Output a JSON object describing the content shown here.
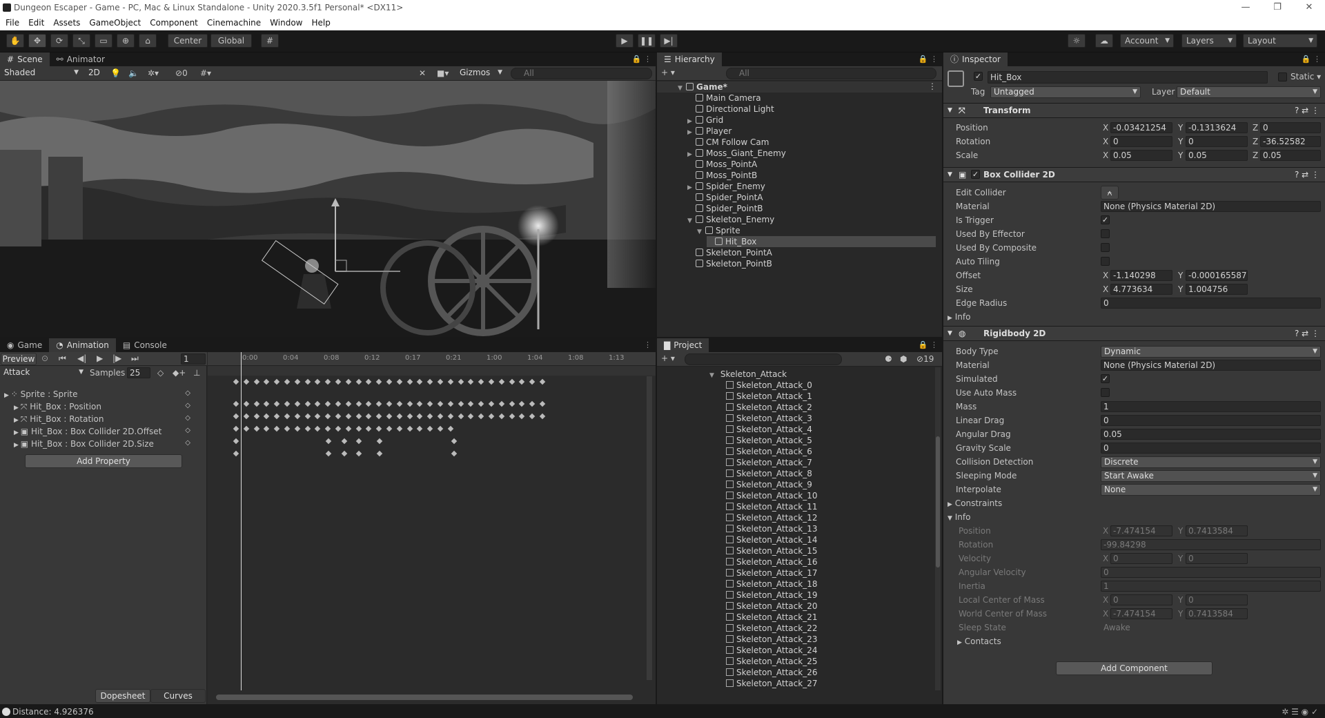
{
  "window": {
    "title": "Dungeon Escaper - Game - PC, Mac & Linux Standalone - Unity 2020.3.5f1 Personal* <DX11>"
  },
  "menu": [
    "File",
    "Edit",
    "Assets",
    "GameObject",
    "Component",
    "Cinemachine",
    "Window",
    "Help"
  ],
  "toolbar": {
    "pivot": "Center",
    "space": "Global",
    "account": "Account",
    "layers": "Layers",
    "layout": "Layout"
  },
  "scene": {
    "tabs": [
      "Scene",
      "Animator"
    ],
    "shading": "Shaded",
    "mode2d": "2D",
    "gizmos": "Gizmos",
    "search": "All",
    "hidden_count": "0"
  },
  "hierarchy": {
    "tab": "Hierarchy",
    "search": "All",
    "scene": "Game*",
    "items": [
      {
        "label": "Main Camera",
        "fold": ""
      },
      {
        "label": "Directional Light",
        "fold": ""
      },
      {
        "label": "Grid",
        "fold": "▶"
      },
      {
        "label": "Player",
        "fold": "▶"
      },
      {
        "label": "CM Follow Cam",
        "fold": ""
      },
      {
        "label": "Moss_Giant_Enemy",
        "fold": "▶"
      },
      {
        "label": "Moss_PointA",
        "fold": ""
      },
      {
        "label": "Moss_PointB",
        "fold": ""
      },
      {
        "label": "Spider_Enemy",
        "fold": "▶"
      },
      {
        "label": "Spider_PointA",
        "fold": ""
      },
      {
        "label": "Spider_PointB",
        "fold": ""
      },
      {
        "label": "Skeleton_Enemy",
        "fold": "▼"
      },
      {
        "label": "Sprite",
        "fold": "▼"
      },
      {
        "label": "Hit_Box",
        "fold": ""
      },
      {
        "label": "Skeleton_PointA",
        "fold": ""
      },
      {
        "label": "Skeleton_PointB",
        "fold": ""
      }
    ]
  },
  "animation": {
    "tabs": [
      "Game",
      "Animation",
      "Console"
    ],
    "preview": "Preview",
    "frame": "1",
    "clip": "Attack",
    "samples_label": "Samples",
    "samples": "25",
    "ruler": [
      "0:00",
      "0:04",
      "0:08",
      "0:12",
      "0:17",
      "0:21",
      "1:00",
      "1:04",
      "1:08",
      "1:13"
    ],
    "properties": [
      "Sprite : Sprite",
      "Hit_Box : Position",
      "Hit_Box : Rotation",
      "Hit_Box : Box Collider 2D.Offset",
      "Hit_Box : Box Collider 2D.Size"
    ],
    "add_property": "Add Property",
    "dopesheet": "Dopesheet",
    "curves": "Curves"
  },
  "project": {
    "tab": "Project",
    "folder": "Skeleton_Attack",
    "count": "19",
    "items": [
      "Skeleton_Attack_0",
      "Skeleton_Attack_1",
      "Skeleton_Attack_2",
      "Skeleton_Attack_3",
      "Skeleton_Attack_4",
      "Skeleton_Attack_5",
      "Skeleton_Attack_6",
      "Skeleton_Attack_7",
      "Skeleton_Attack_8",
      "Skeleton_Attack_9",
      "Skeleton_Attack_10",
      "Skeleton_Attack_11",
      "Skeleton_Attack_12",
      "Skeleton_Attack_13",
      "Skeleton_Attack_14",
      "Skeleton_Attack_15",
      "Skeleton_Attack_16",
      "Skeleton_Attack_17",
      "Skeleton_Attack_18",
      "Skeleton_Attack_19",
      "Skeleton_Attack_20",
      "Skeleton_Attack_21",
      "Skeleton_Attack_22",
      "Skeleton_Attack_23",
      "Skeleton_Attack_24",
      "Skeleton_Attack_25",
      "Skeleton_Attack_26",
      "Skeleton_Attack_27"
    ]
  },
  "inspector": {
    "tab": "Inspector",
    "name": "Hit_Box",
    "static": "Static",
    "tag_label": "Tag",
    "tag": "Untagged",
    "layer_label": "Layer",
    "layer": "Default",
    "transform": {
      "title": "Transform",
      "position": {
        "label": "Position",
        "x": "-0.03421254",
        "y": "-0.1313624",
        "z": "0"
      },
      "rotation": {
        "label": "Rotation",
        "x": "0",
        "y": "0",
        "z": "-36.52582"
      },
      "scale": {
        "label": "Scale",
        "x": "0.05",
        "y": "0.05",
        "z": "0.05"
      }
    },
    "collider": {
      "title": "Box Collider 2D",
      "edit": "Edit Collider",
      "material_label": "Material",
      "material": "None (Physics Material 2D)",
      "is_trigger": "Is Trigger",
      "used_by_effector": "Used By Effector",
      "used_by_composite": "Used By Composite",
      "auto_tiling": "Auto Tiling",
      "offset_label": "Offset",
      "offset_x": "-1.140298",
      "offset_y": "-0.0001655873",
      "size_label": "Size",
      "size_x": "4.773634",
      "size_y": "1.004756",
      "edge_label": "Edge Radius",
      "edge": "0",
      "info": "Info"
    },
    "rigidbody": {
      "title": "Rigidbody 2D",
      "body_type_label": "Body Type",
      "body_type": "Dynamic",
      "material_label": "Material",
      "material": "None (Physics Material 2D)",
      "simulated": "Simulated",
      "use_auto_mass": "Use Auto Mass",
      "mass_label": "Mass",
      "mass": "1",
      "linear_drag_label": "Linear Drag",
      "linear_drag": "0",
      "angular_drag_label": "Angular Drag",
      "angular_drag": "0.05",
      "gravity_label": "Gravity Scale",
      "gravity": "0",
      "collision_label": "Collision Detection",
      "collision": "Discrete",
      "sleeping_label": "Sleeping Mode",
      "sleeping": "Start Awake",
      "interpolate_label": "Interpolate",
      "interpolate": "None",
      "constraints": "Constraints",
      "info": "Info",
      "info_position_label": "Position",
      "info_pos_x": "-7.474154",
      "info_pos_y": "0.7413584",
      "info_rotation_label": "Rotation",
      "info_rotation": "-99.84298",
      "velocity_label": "Velocity",
      "vel_x": "0",
      "vel_y": "0",
      "ang_vel_label": "Angular Velocity",
      "ang_vel": "0",
      "inertia_label": "Inertia",
      "inertia": "1",
      "local_com_label": "Local Center of Mass",
      "lcom_x": "0",
      "lcom_y": "0",
      "world_com_label": "World Center of Mass",
      "wcom_x": "-7.474154",
      "wcom_y": "0.7413584",
      "sleep_state_label": "Sleep State",
      "sleep_state": "Awake",
      "contacts": "Contacts"
    },
    "add_component": "Add Component"
  },
  "status": {
    "text": "Distance: 4.926376"
  }
}
